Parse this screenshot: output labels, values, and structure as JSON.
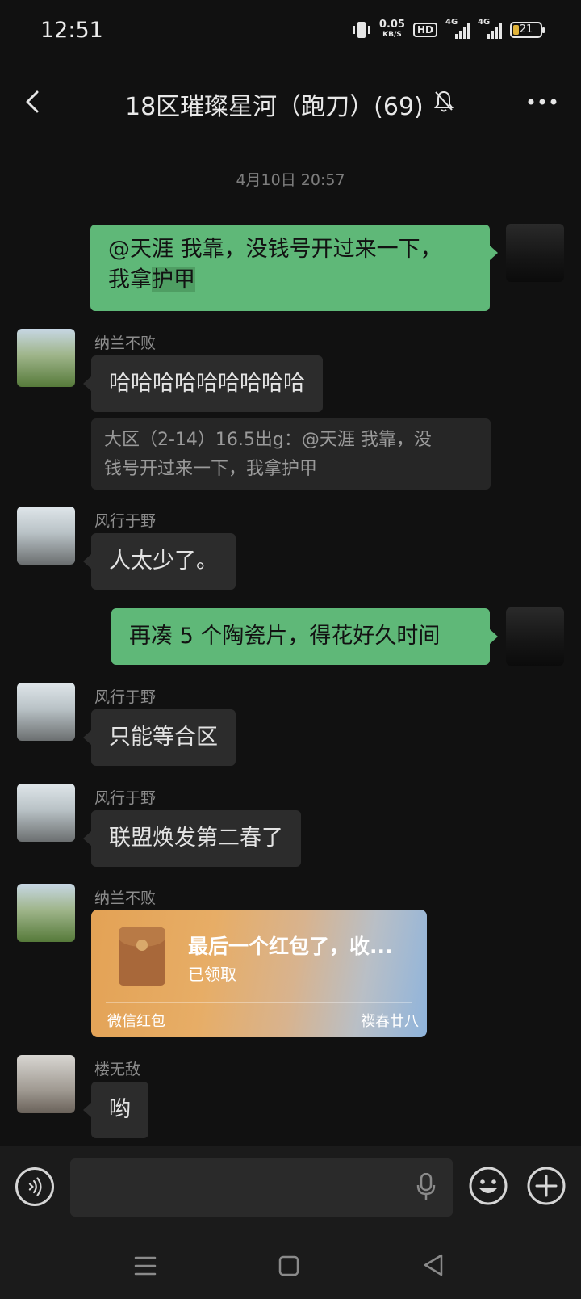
{
  "status_bar": {
    "time": "12:51",
    "net_speed": "0.05",
    "net_speed_unit": "KB/S",
    "hd_badge": "HD",
    "signal1_label": "4G",
    "signal2_label": "4G",
    "battery": "21",
    "battery_level_percent": 21
  },
  "header": {
    "title": "18区璀璨星河（跑刀）(69)",
    "back_icon": "chevron-left-icon",
    "mute_icon": "bell-off-icon",
    "more_icon": "more-horizontal-icon"
  },
  "chat": {
    "timestamp": "4月10日 20:57",
    "messages": [
      {
        "sender": "",
        "outgoing": true,
        "line1": "@天涯  我靠，没钱号开过来一下，",
        "line2_plain": "我拿",
        "line2_highlight": "护甲"
      },
      {
        "sender": "纳兰不败",
        "outgoing": false,
        "text": "哈哈哈哈哈哈哈哈哈"
      },
      {
        "quote_line1": "大区（2-14）16.5出g：@天涯 我靠，没",
        "quote_line2": "钱号开过来一下，我拿护甲"
      },
      {
        "sender": "风行于野",
        "outgoing": false,
        "text": "人太少了。"
      },
      {
        "sender": "",
        "outgoing": true,
        "text": "再凑 5 个陶瓷片，得花好久时间"
      },
      {
        "sender": "风行于野",
        "outgoing": false,
        "text": "只能等合区"
      },
      {
        "sender": "风行于野",
        "outgoing": false,
        "text": "联盟焕发第二春了"
      },
      {
        "sender": "纳兰不败",
        "outgoing": false,
        "red_packet": {
          "title": "最后一个红包了，收...",
          "status": "已领取",
          "label": "微信红包",
          "theme": "禊春廿八"
        }
      },
      {
        "sender": "楼无敌",
        "outgoing": false,
        "text": "哟"
      }
    ]
  },
  "input_bar": {
    "placeholder": "",
    "voice_icon": "voice-mode-icon",
    "mic_icon": "microphone-icon",
    "emoji_icon": "emoji-icon",
    "plus_icon": "plus-icon"
  },
  "nav_bar": {
    "menu_icon": "menu-icon",
    "home_icon": "home-icon",
    "back_icon": "back-triangle-icon"
  },
  "colors": {
    "background": "#111111",
    "outgoing_bubble": "#5fb878",
    "incoming_bubble": "#2c2c2c",
    "red_packet": "#e3a255"
  }
}
